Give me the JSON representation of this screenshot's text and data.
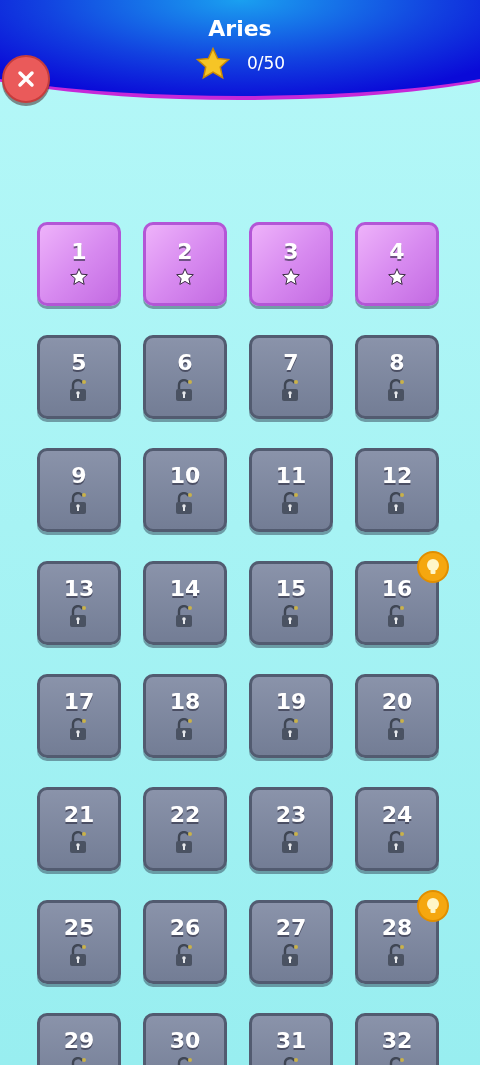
{
  "header": {
    "title": "Aries",
    "score": "0/50"
  },
  "levels": [
    {
      "number": "1",
      "kind": "open",
      "hint": false
    },
    {
      "number": "2",
      "kind": "open",
      "hint": false
    },
    {
      "number": "3",
      "kind": "open",
      "hint": false
    },
    {
      "number": "4",
      "kind": "open",
      "hint": false
    },
    {
      "number": "5",
      "kind": "locked",
      "hint": false
    },
    {
      "number": "6",
      "kind": "locked",
      "hint": false
    },
    {
      "number": "7",
      "kind": "locked",
      "hint": false
    },
    {
      "number": "8",
      "kind": "locked",
      "hint": false
    },
    {
      "number": "9",
      "kind": "locked",
      "hint": false
    },
    {
      "number": "10",
      "kind": "locked",
      "hint": false
    },
    {
      "number": "11",
      "kind": "locked",
      "hint": false
    },
    {
      "number": "12",
      "kind": "locked",
      "hint": false
    },
    {
      "number": "13",
      "kind": "locked",
      "hint": false
    },
    {
      "number": "14",
      "kind": "locked",
      "hint": false
    },
    {
      "number": "15",
      "kind": "locked",
      "hint": false
    },
    {
      "number": "16",
      "kind": "locked",
      "hint": true
    },
    {
      "number": "17",
      "kind": "locked",
      "hint": false
    },
    {
      "number": "18",
      "kind": "locked",
      "hint": false
    },
    {
      "number": "19",
      "kind": "locked",
      "hint": false
    },
    {
      "number": "20",
      "kind": "locked",
      "hint": false
    },
    {
      "number": "21",
      "kind": "locked",
      "hint": false
    },
    {
      "number": "22",
      "kind": "locked",
      "hint": false
    },
    {
      "number": "23",
      "kind": "locked",
      "hint": false
    },
    {
      "number": "24",
      "kind": "locked",
      "hint": false
    },
    {
      "number": "25",
      "kind": "locked",
      "hint": false
    },
    {
      "number": "26",
      "kind": "locked",
      "hint": false
    },
    {
      "number": "27",
      "kind": "locked",
      "hint": false
    },
    {
      "number": "28",
      "kind": "locked",
      "hint": true
    },
    {
      "number": "29",
      "kind": "locked",
      "hint": false
    },
    {
      "number": "30",
      "kind": "locked",
      "hint": false
    },
    {
      "number": "31",
      "kind": "locked",
      "hint": false
    },
    {
      "number": "32",
      "kind": "locked",
      "hint": false
    }
  ]
}
